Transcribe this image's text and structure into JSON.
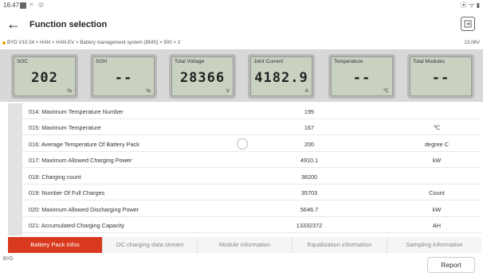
{
  "status": {
    "time": "16:47",
    "icons": [
      "image-icon",
      "signal-icon"
    ],
    "right_icons": "⦿ ᯤ ▮"
  },
  "header": {
    "title": "Function selection"
  },
  "breadcrumb": {
    "path": "BYD V10.34 > HAN > HAN EV > Battery management system (BMS) > 500 > 2",
    "voltage": "13.06V"
  },
  "gauges": [
    {
      "label": "SOC",
      "value": "202",
      "unit": "%"
    },
    {
      "label": "SOH",
      "value": "--",
      "unit": "%"
    },
    {
      "label": "Total Voltage",
      "value": "28366",
      "unit": "V"
    },
    {
      "label": "Joint Current",
      "value": "4182.9",
      "unit": "A"
    },
    {
      "label": "Temperature",
      "value": "--",
      "unit": "℃"
    },
    {
      "label": "Total Modules",
      "value": "--",
      "unit": ""
    }
  ],
  "rows": [
    {
      "name": "014: Maximum Temperature Number",
      "value": "195",
      "unit": ""
    },
    {
      "name": "015: Maximum Temperature",
      "value": "167",
      "unit": "℃"
    },
    {
      "name": "016: Average Temperature Of Battery Pack",
      "value": "200",
      "unit": "degree C"
    },
    {
      "name": "017: Maximum Allowed Charging Power",
      "value": "4910.1",
      "unit": "kW"
    },
    {
      "name": "018: Charging count",
      "value": "38200",
      "unit": ""
    },
    {
      "name": "019: Number Of Full Charges",
      "value": "35703",
      "unit": "Count"
    },
    {
      "name": "020: Maximum Allowed Discharging Power",
      "value": "5646.7",
      "unit": "kW"
    },
    {
      "name": "021: Accumulated Charging Capacity",
      "value": "13332372",
      "unit": "AH"
    }
  ],
  "tabs": [
    "Battery Pack Infos",
    "DC charging data stream",
    "Module information",
    "Equalization information",
    "Sampling information"
  ],
  "footer": {
    "brand": "BYD",
    "report_label": "Report"
  },
  "colors": {
    "accent": "#d93a1e",
    "lcd": "#c9d2c0"
  }
}
